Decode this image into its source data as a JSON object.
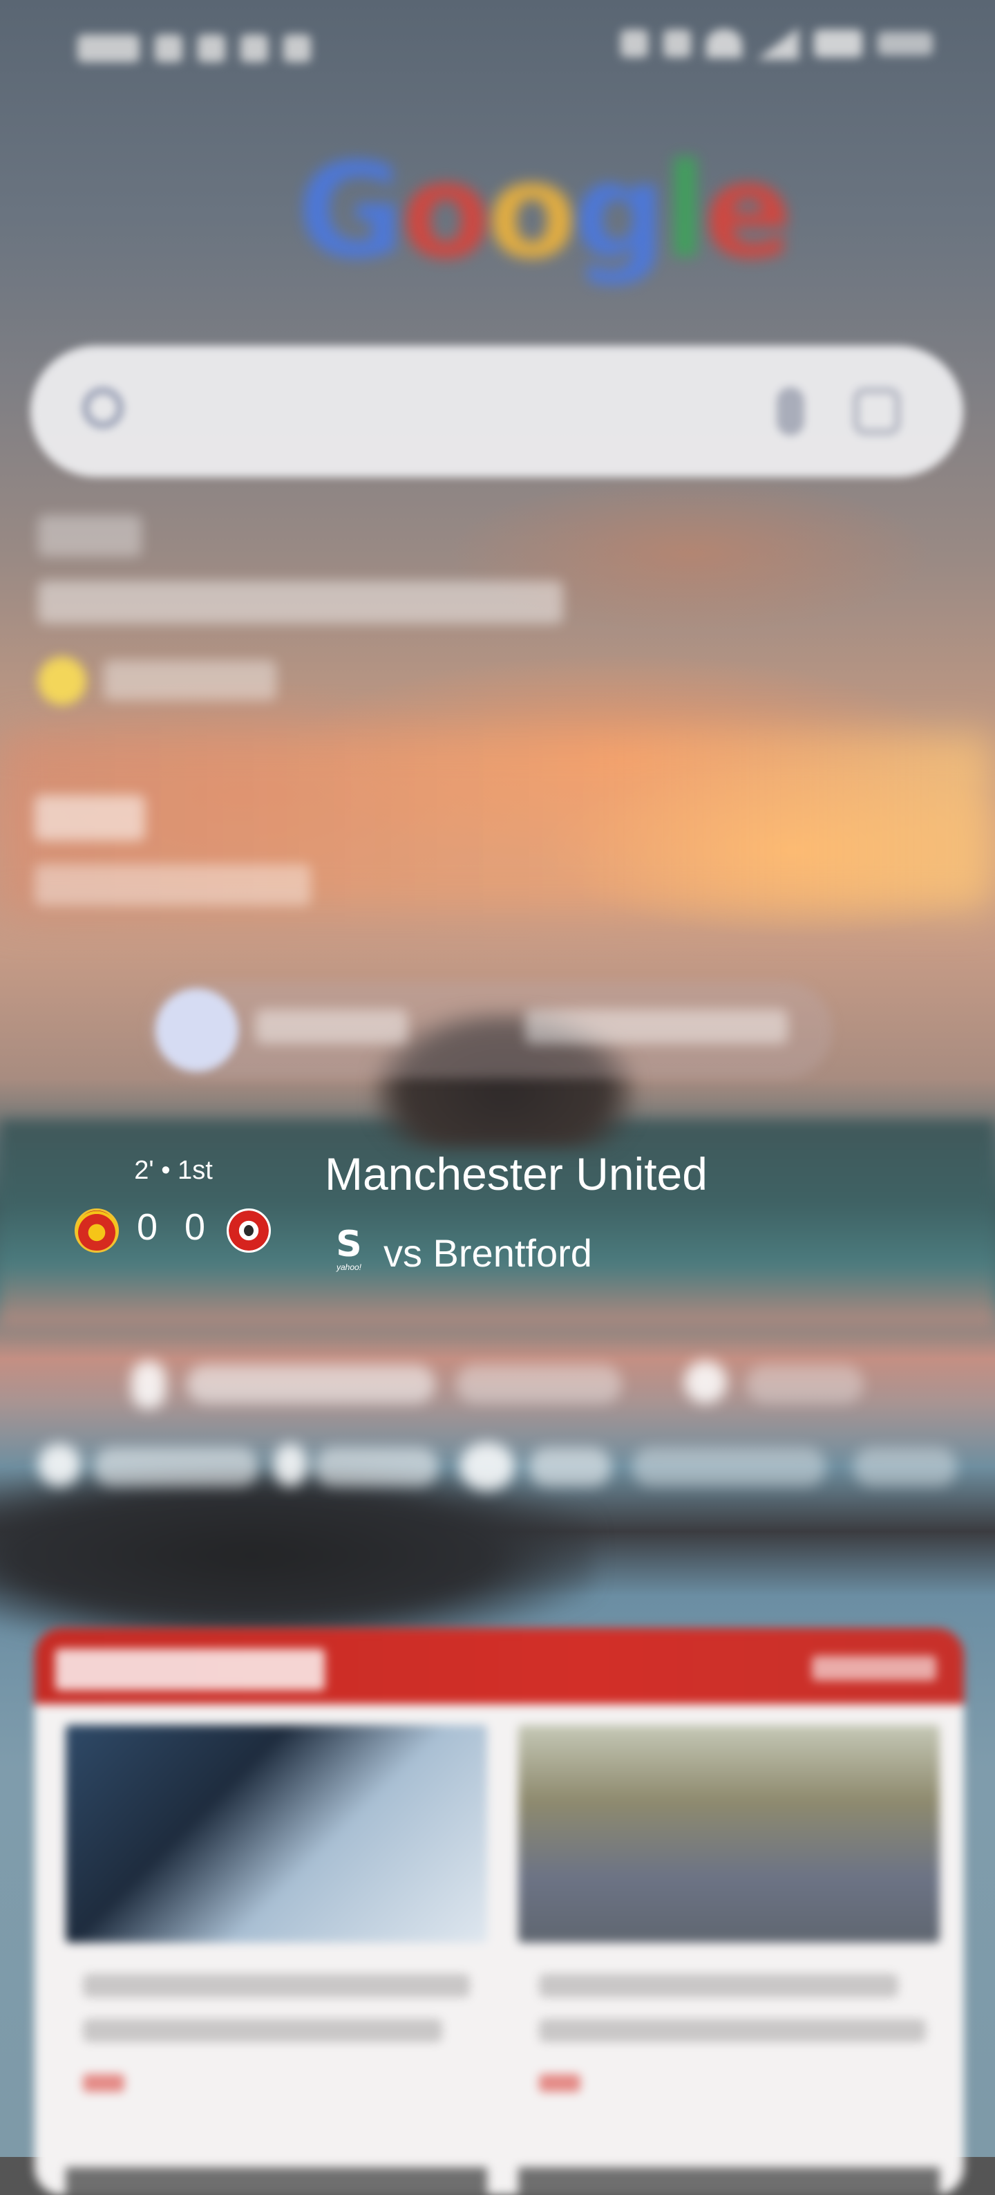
{
  "google_logo": {
    "letters": [
      {
        "char": "G",
        "color": "#4a78e0"
      },
      {
        "char": "o",
        "color": "#d9433a"
      },
      {
        "char": "o",
        "color": "#f0b43a"
      },
      {
        "char": "g",
        "color": "#4a78e0"
      },
      {
        "char": "l",
        "color": "#3ea35a"
      },
      {
        "char": "e",
        "color": "#d9433a"
      }
    ]
  },
  "score_widget": {
    "match_status": "2' • 1st",
    "home_score": "0",
    "away_score": "0",
    "title": "Manchester United",
    "opponent": "vs Brentford",
    "provider_logo": "S",
    "provider_sub": "yahoo!",
    "home_crest_icon": "manchester-united-crest-icon",
    "away_crest_icon": "brentford-crest-icon"
  },
  "colors": {
    "news_header_red": "#d22f28",
    "search_bar": "#f0f0f2"
  }
}
